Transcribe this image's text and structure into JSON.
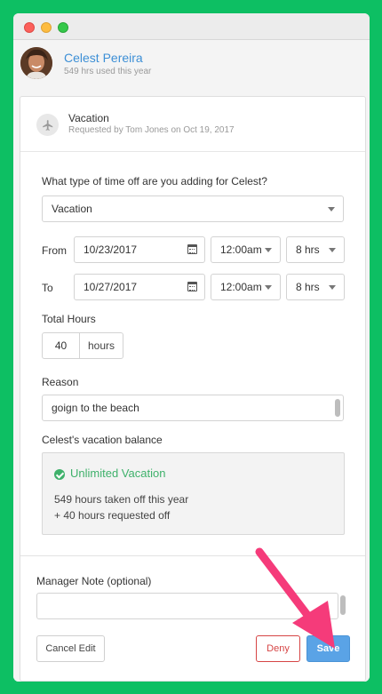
{
  "user": {
    "name": "Celest Pereira",
    "subtitle": "549 hrs used this year"
  },
  "request": {
    "type_title": "Vacation",
    "requested_by": "Requested by Tom Jones on Oct 19, 2017"
  },
  "form": {
    "question": "What type of time off are you adding for Celest?",
    "type_selected": "Vacation",
    "from_label": "From",
    "to_label": "To",
    "from_date": "10/23/2017",
    "from_time": "12:00am",
    "from_hours": "8 hrs",
    "to_date": "10/27/2017",
    "to_time": "12:00am",
    "to_hours": "8 hrs",
    "total_hours_label": "Total Hours",
    "total_hours_value": "40",
    "total_hours_unit": "hours",
    "reason_label": "Reason",
    "reason_value": "goign to the beach"
  },
  "balance": {
    "label": "Celest's vacation balance",
    "title": "Unlimited Vacation",
    "line1": "549 hours taken off this year",
    "line2": "+ 40 hours requested off"
  },
  "manager": {
    "note_label": "Manager Note (optional)",
    "note_value": ""
  },
  "buttons": {
    "cancel": "Cancel Edit",
    "deny": "Deny",
    "save": "Save"
  },
  "colors": {
    "background": "#0dbf63",
    "accent_blue": "#5aa3e6",
    "deny_red": "#d64545",
    "success_green": "#3fb16b",
    "arrow_pink": "#f53b7a"
  }
}
